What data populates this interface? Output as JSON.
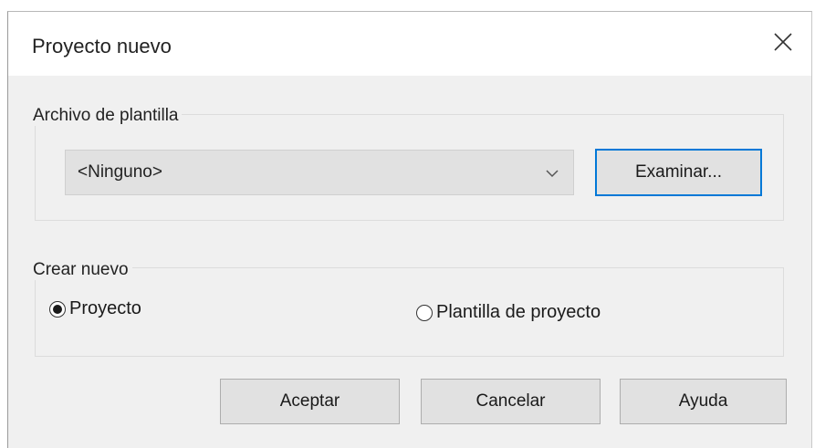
{
  "dialog": {
    "title": "Proyecto nuevo",
    "close_icon": "close-icon"
  },
  "template_group": {
    "label": "Archivo de plantilla",
    "combo_value": "<Ninguno>",
    "combo_icon": "chevron-down-icon",
    "browse_label": "Examinar..."
  },
  "create_group": {
    "label": "Crear nuevo",
    "options": [
      {
        "label": "Proyecto",
        "selected": true
      },
      {
        "label": "Plantilla de proyecto",
        "selected": false
      }
    ]
  },
  "buttons": {
    "ok_label": "Aceptar",
    "cancel_label": "Cancelar",
    "help_label": "Ayuda"
  },
  "colors": {
    "accent": "#0078d7",
    "dialog_bg": "#f0f0f0",
    "button_bg": "#e1e1e1"
  }
}
